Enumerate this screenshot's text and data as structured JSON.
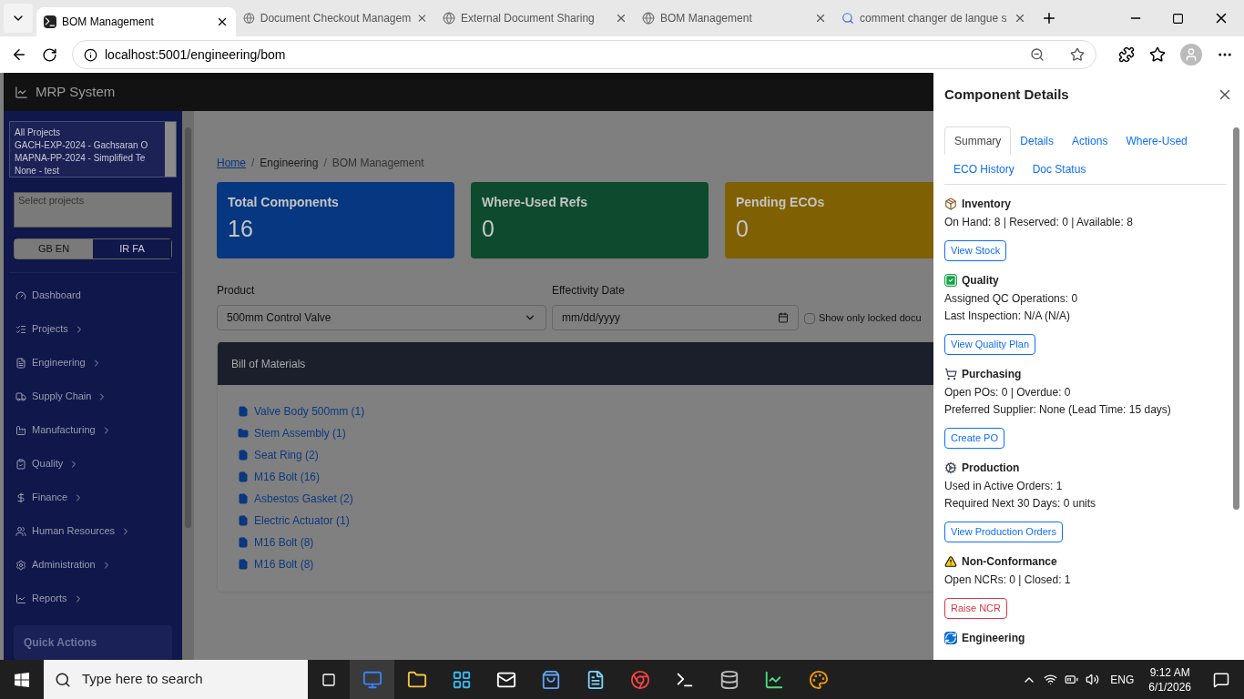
{
  "browser": {
    "tabs": [
      {
        "title": "BOM Management",
        "selected": true,
        "kind": "terminal"
      },
      {
        "title": "Document Checkout Managem",
        "selected": false,
        "kind": "globe"
      },
      {
        "title": "External Document Sharing",
        "selected": false,
        "kind": "globe"
      },
      {
        "title": "BOM Management",
        "selected": false,
        "kind": "globe"
      },
      {
        "title": "comment changer de langue s",
        "selected": false,
        "kind": "search"
      }
    ],
    "address": "localhost:5001/engineering/bom"
  },
  "app": {
    "brand": "MRP System",
    "projects": [
      "All Projects",
      "GACH-EXP-2024 - Gachsaran O",
      "MAPNA-PP-2024 - Simplified Te",
      "None - test"
    ],
    "project_search": {
      "placeholder": "Select projects"
    },
    "languages": [
      {
        "flag": "GB",
        "label": "EN",
        "selected": true
      },
      {
        "flag": "IR",
        "label": "FA",
        "selected": false
      }
    ],
    "nav": [
      {
        "label": "Dashboard",
        "expandable": false
      },
      {
        "label": "Projects",
        "expandable": true
      },
      {
        "label": "Engineering",
        "expandable": true
      },
      {
        "label": "Supply Chain",
        "expandable": true
      },
      {
        "label": "Manufacturing",
        "expandable": true
      },
      {
        "label": "Quality",
        "expandable": true
      },
      {
        "label": "Finance",
        "expandable": true
      },
      {
        "label": "Human Resources",
        "expandable": true
      },
      {
        "label": "Administration",
        "expandable": true
      },
      {
        "label": "Reports",
        "expandable": true
      }
    ],
    "quick_actions": "Quick Actions",
    "breadcrumb": {
      "separator": "/",
      "items": [
        {
          "label": "Home",
          "link": true
        },
        {
          "label": "Engineering",
          "link": false
        },
        {
          "label": "BOM Management",
          "link": false
        }
      ]
    },
    "stats": [
      {
        "title": "Total Components",
        "value": "16",
        "color": "#073780"
      },
      {
        "title": "Where-Used Refs",
        "value": "0",
        "color": "#0d4a2e"
      },
      {
        "title": "Pending ECOs",
        "value": "0",
        "color": "#7f6003"
      }
    ],
    "filters": {
      "product_label": "Product",
      "product_value": "500mm Control Valve",
      "date_label": "Effectivity Date",
      "date_placeholder": "mm/dd/yyyy",
      "locked_label": "Show only locked docu",
      "locked_checked": false
    },
    "bom": {
      "title": "Bill of Materials",
      "items": [
        {
          "label": "Valve Body 500mm (1)",
          "kind": "file"
        },
        {
          "label": "Stem Assembly (1)",
          "kind": "folder"
        },
        {
          "label": "Seat Ring (2)",
          "kind": "file"
        },
        {
          "label": "M16 Bolt (16)",
          "kind": "file"
        },
        {
          "label": "Asbestos Gasket (2)",
          "kind": "file"
        },
        {
          "label": "Electric Actuator (1)",
          "kind": "file"
        },
        {
          "label": "M16 Bolt (8)",
          "kind": "file"
        },
        {
          "label": "M16 Bolt (8)",
          "kind": "file"
        }
      ]
    }
  },
  "panel": {
    "title": "Component Details",
    "tabs": [
      {
        "label": "Summary",
        "selected": true
      },
      {
        "label": "Details",
        "selected": false
      },
      {
        "label": "Actions",
        "selected": false
      },
      {
        "label": "Where-Used",
        "selected": false
      },
      {
        "label": "ECO History",
        "selected": false
      },
      {
        "label": "Doc Status",
        "selected": false
      }
    ],
    "sections": [
      {
        "kind": "inventory",
        "title": "Inventory",
        "lines": [
          "On Hand: 8 | Reserved: 0 | Available: 8"
        ],
        "button": {
          "label": "View Stock",
          "kind": "primary"
        }
      },
      {
        "kind": "quality",
        "title": "Quality",
        "lines": [
          "Assigned QC Operations: 0",
          "Last Inspection: N/A (N/A)"
        ],
        "button": {
          "label": "View Quality Plan",
          "kind": "primary"
        }
      },
      {
        "kind": "purchasing",
        "title": "Purchasing",
        "lines": [
          "Open POs: 0 | Overdue: 0",
          "Preferred Supplier: None (Lead Time: 15 days)"
        ],
        "button": {
          "label": "Create PO",
          "kind": "primary"
        }
      },
      {
        "kind": "production",
        "title": "Production",
        "lines": [
          "Used in Active Orders: 1",
          "Required Next 30 Days: 0 units"
        ],
        "button": {
          "label": "View Production Orders",
          "kind": "primary"
        }
      },
      {
        "kind": "ncr",
        "title": "Non-Conformance",
        "lines": [
          "Open NCRs: 0 | Closed: 1"
        ],
        "button": {
          "label": "Raise NCR",
          "kind": "danger"
        }
      },
      {
        "kind": "engineering",
        "title": "Engineering"
      }
    ]
  },
  "taskbar": {
    "search_placeholder": "Type here to search",
    "language": "ENG",
    "time": "9:12 AM",
    "date": "6/1/2026"
  }
}
